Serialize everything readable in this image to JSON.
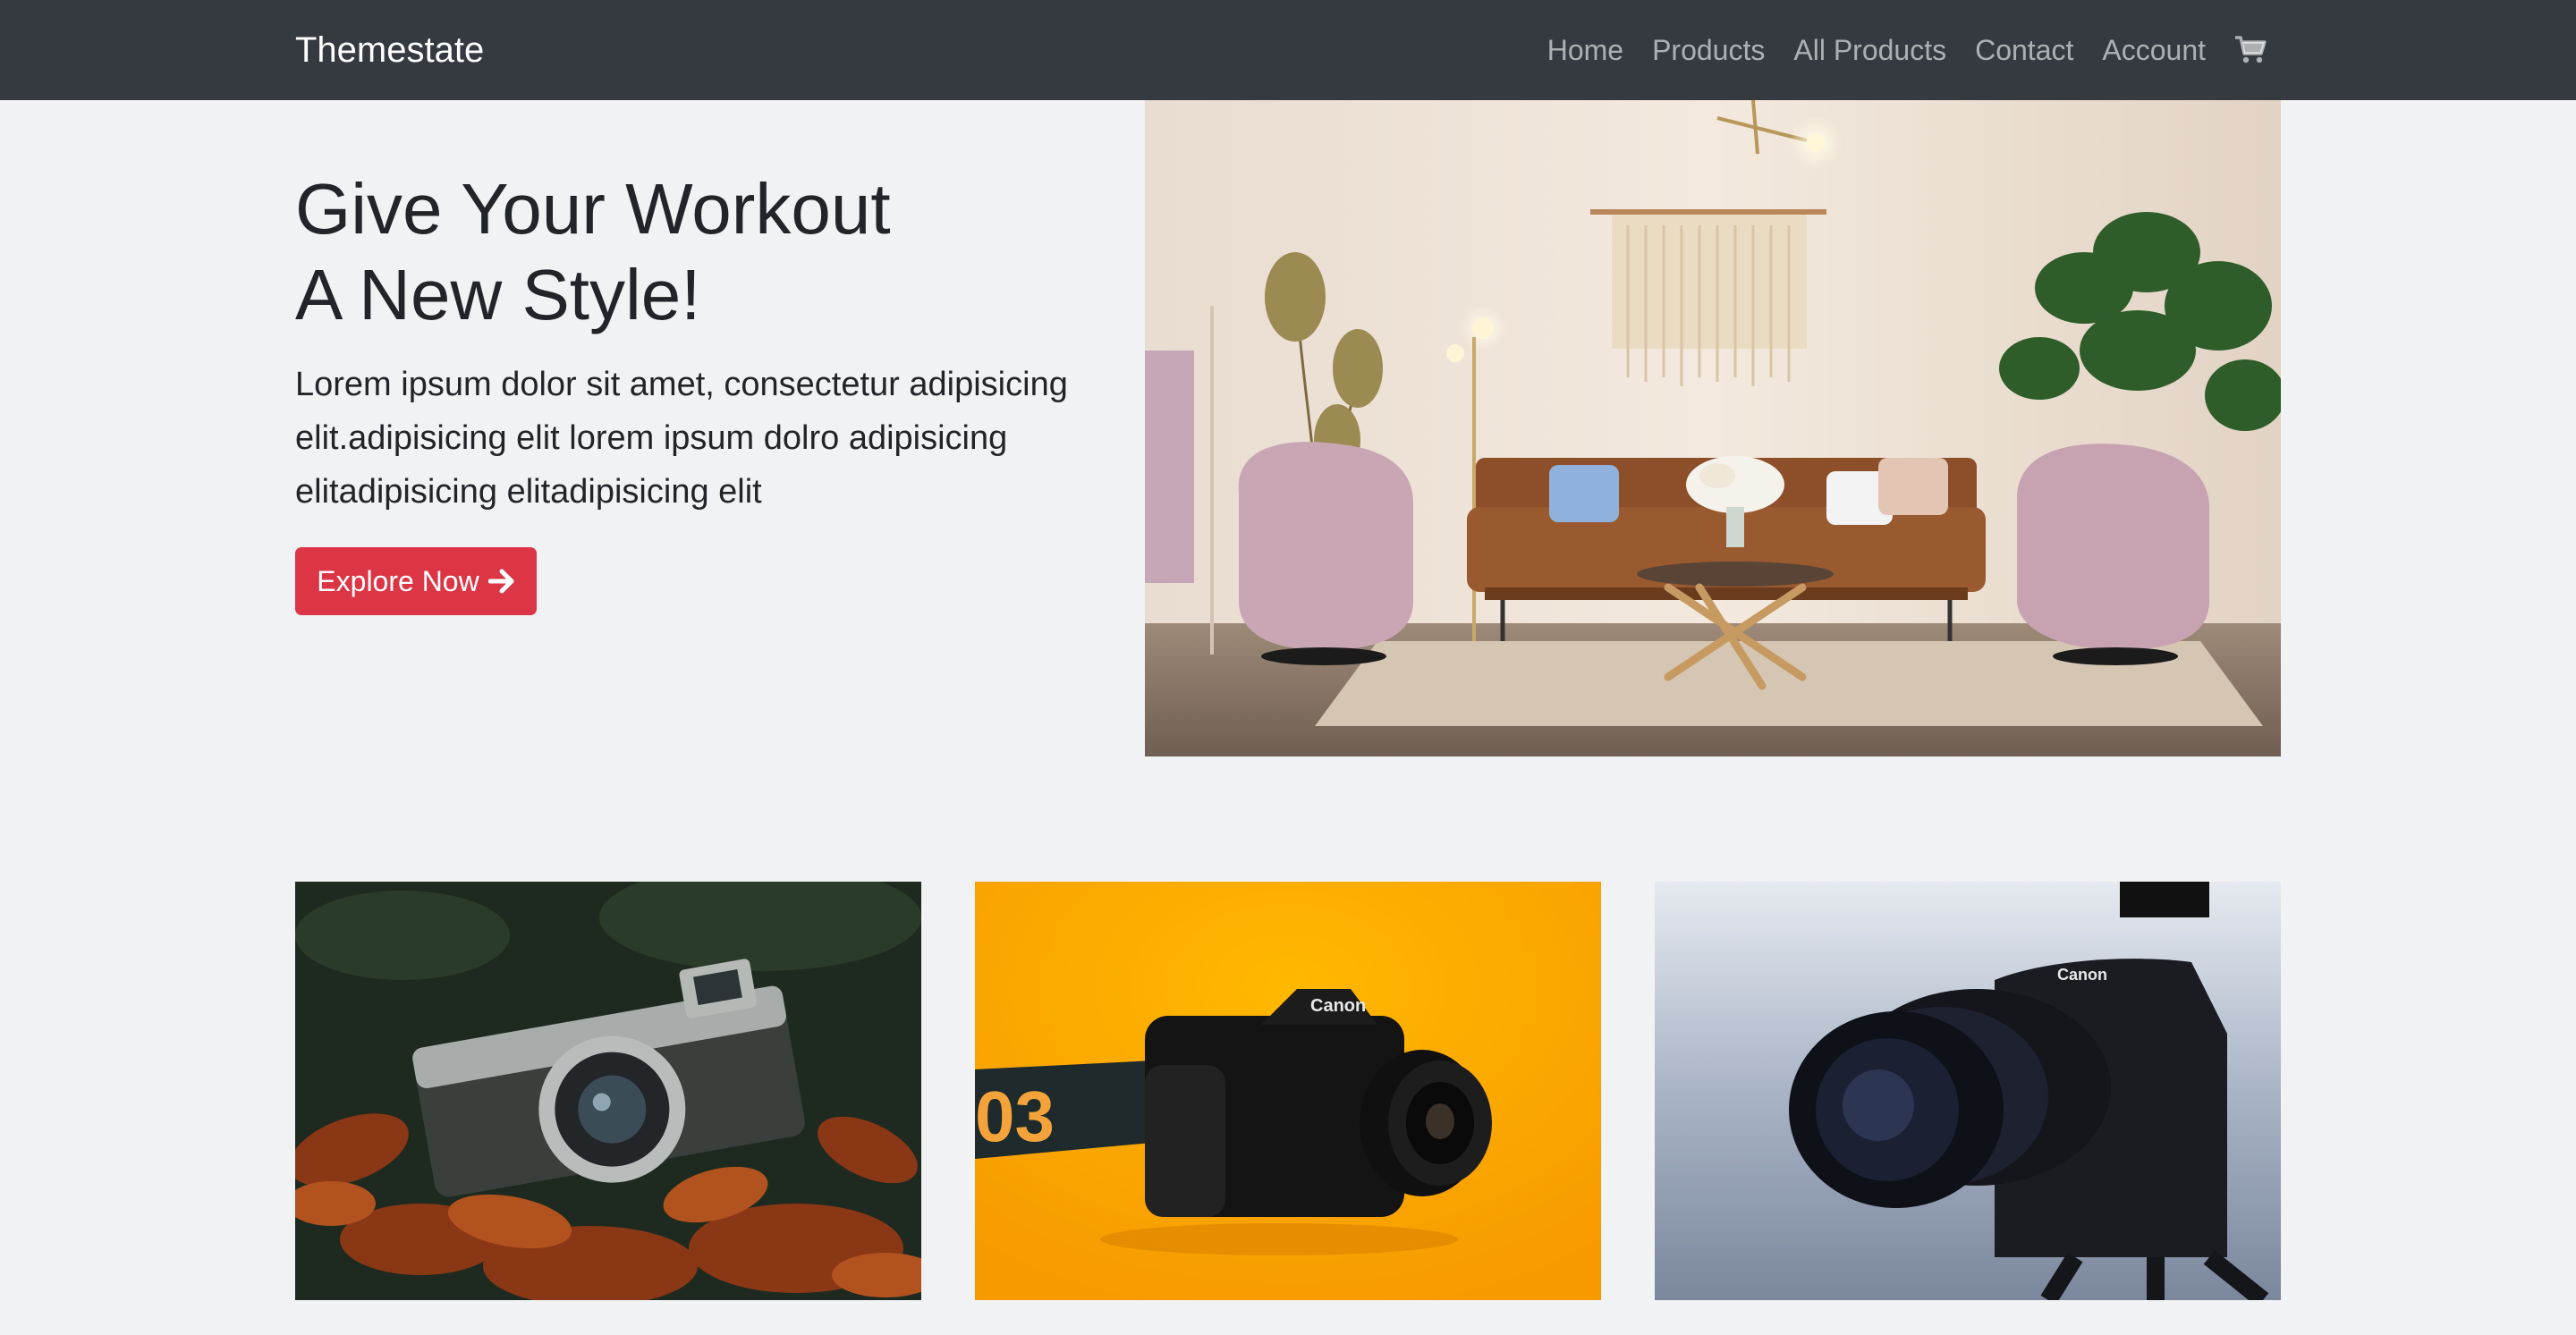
{
  "navbar": {
    "brand": "Themestate",
    "links": [
      "Home",
      "Products",
      "All Products",
      "Contact",
      "Account"
    ],
    "cart_icon": "shopping-cart-icon"
  },
  "hero": {
    "title_line1": "Give Your Workout",
    "title_line2": "A New Style!",
    "text": "Lorem ipsum dolor sit amet, consectetur adipisicing elit.adipisicing elit lorem ipsum dolro adipisicing elitadipisicing elitadipisicing elit",
    "button_label": "Explore Now",
    "button_icon": "arrow-right-icon",
    "image": "living-room-photo"
  },
  "gallery": {
    "images": [
      "vintage-camera-on-leaves-photo",
      "canon-camera-yellow-background-photo",
      "canon-camera-on-tripod-photo"
    ]
  },
  "colors": {
    "navbar_bg": "#343a40",
    "page_bg": "#f1f2f4",
    "accent": "#dc3545"
  }
}
